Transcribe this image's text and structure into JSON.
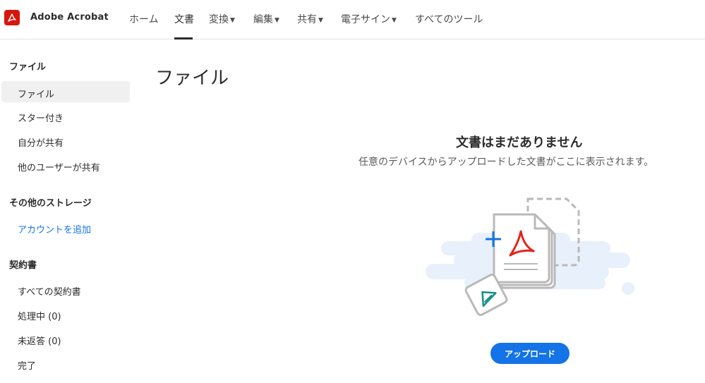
{
  "app": {
    "brand": "Adobe Acrobat"
  },
  "nav": {
    "items": [
      {
        "label": "ホーム",
        "dropdown": false
      },
      {
        "label": "文書",
        "dropdown": false,
        "active": true
      },
      {
        "label": "変換",
        "dropdown": true
      },
      {
        "label": "編集",
        "dropdown": true
      },
      {
        "label": "共有",
        "dropdown": true
      },
      {
        "label": "電子サイン",
        "dropdown": true
      },
      {
        "label": "すべてのツール",
        "dropdown": false
      }
    ]
  },
  "sidebar": {
    "files_heading": "ファイル",
    "files_items": [
      "ファイル",
      "スター付き",
      "自分が共有",
      "他のユーザーが共有"
    ],
    "storage_heading": "その他のストレージ",
    "add_account": "アカウントを追加",
    "agreements_heading": "契約書",
    "agreements_items": [
      "すべての契約書",
      "処理中 (0)",
      "未返答 (0)",
      "完了"
    ]
  },
  "main": {
    "title": "ファイル",
    "empty_title": "文書はまだありません",
    "empty_subtitle": "任意のデバイスからアップロードした文書がここに表示されます。",
    "upload_label": "アップロード"
  },
  "colors": {
    "accent": "#1473e6",
    "brand_red": "#d7170c",
    "selected_bg": "#f0f0f0"
  }
}
